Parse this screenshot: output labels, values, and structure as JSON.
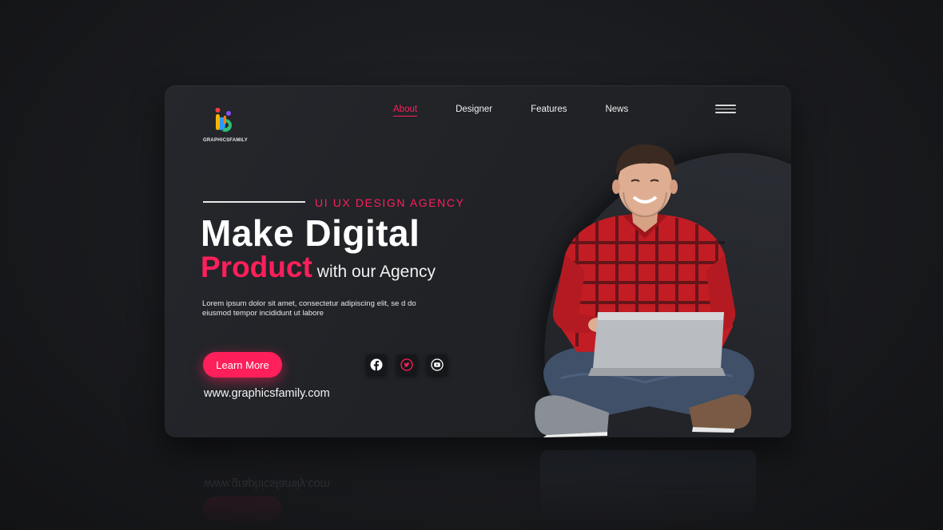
{
  "brand": {
    "name": "GRAPHICSFAMILY"
  },
  "nav": {
    "items": [
      {
        "label": "About",
        "active": true
      },
      {
        "label": "Designer",
        "active": false
      },
      {
        "label": "Features",
        "active": false
      },
      {
        "label": "News",
        "active": false
      }
    ],
    "menu_icon": "hamburger-icon"
  },
  "hero": {
    "tagline": "UI UX DESIGN AGENCY",
    "headline_line1": "Make Digital",
    "headline_accent": "Product",
    "headline_rest": "with our Agency",
    "description": "Lorem ipsum dolor sit amet, consectetur adipiscing elit, se d do eiusmod tempor incididunt ut labore",
    "cta_label": "Learn More",
    "website": "www.graphicsfamily.com"
  },
  "social": [
    {
      "name": "facebook-icon"
    },
    {
      "name": "twitter-icon"
    },
    {
      "name": "youtube-icon"
    }
  ],
  "colors": {
    "accent": "#ff1f5a",
    "background": "#1a1b1e",
    "card": "#222428"
  }
}
